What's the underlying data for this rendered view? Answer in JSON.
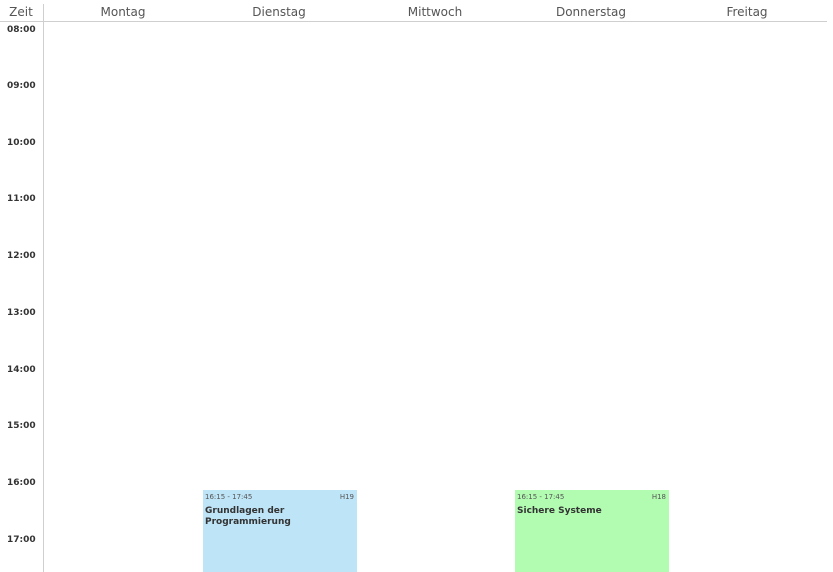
{
  "header": {
    "time_column": "Zeit",
    "days": [
      "Montag",
      "Dienstag",
      "Mittwoch",
      "Donnerstag",
      "Freitag"
    ]
  },
  "time_slots": [
    "08:00",
    "09:00",
    "10:00",
    "11:00",
    "12:00",
    "13:00",
    "14:00",
    "15:00",
    "16:00",
    "17:00"
  ],
  "events": [
    {
      "day": "Dienstag",
      "time": "16:15 - 17:45",
      "room": "H19",
      "title": "Grundlagen der Programmierung",
      "color": "#bee4f7"
    },
    {
      "day": "Donnerstag",
      "time": "16:15 - 17:45",
      "room": "H18",
      "title": "Sichere Systeme",
      "color": "#b2fcb2"
    }
  ],
  "colors": {
    "grid_line": "#cfcfcf",
    "text": "#333333"
  }
}
